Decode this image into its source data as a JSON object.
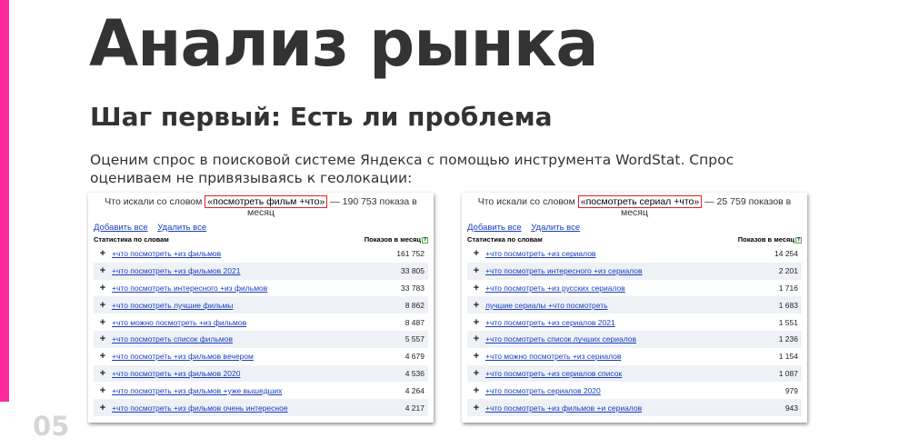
{
  "slide": {
    "title": "Анализ рынка",
    "subtitle": "Шаг первый: Есть ли проблема",
    "description": "Оценим спрос в поисковой системе Яндекса с помощью инструмента WordStat. Спрос оцениваем не привязываясь к геолокации:",
    "page_number": "05",
    "accent_color": "#ff2a9c"
  },
  "wordstat_left": {
    "prefix": "Что искали со словом",
    "phrase": "«посмотреть фильм +что»",
    "suffix": "— 190 753 показа в месяц",
    "add_all": "Добавить все",
    "remove_all": "Удалить все",
    "col_phrase": "Статистика по словам",
    "col_count": "Показов в месяц",
    "help_icon": "?",
    "rows": [
      {
        "icon": "+",
        "phrase": "+что посмотреть +из фильмов",
        "count": "161 752"
      },
      {
        "icon": "+",
        "phrase": "+что посмотреть +из фильмов 2021",
        "count": "33 805"
      },
      {
        "icon": "+",
        "phrase": "+что посмотреть интересного +из фильмов",
        "count": "33 783"
      },
      {
        "icon": "+",
        "phrase": "+что посмотреть лучшие фильмы",
        "count": "8 862"
      },
      {
        "icon": "+",
        "phrase": "+что можно посмотреть +из фильмов",
        "count": "8 487"
      },
      {
        "icon": "+",
        "phrase": "+что посмотреть список фильмов",
        "count": "5 557"
      },
      {
        "icon": "+",
        "phrase": "+что посмотреть +из фильмов вечером",
        "count": "4 679"
      },
      {
        "icon": "+",
        "phrase": "+что посмотреть +из фильмов 2020",
        "count": "4 536"
      },
      {
        "icon": "+",
        "phrase": "+что посмотреть +из фильмов +уже вышедших",
        "count": "4 264"
      },
      {
        "icon": "+",
        "phrase": "+что посмотреть +из фильмов очень интересное",
        "count": "4 217"
      }
    ]
  },
  "wordstat_right": {
    "prefix": "Что искали со словом",
    "phrase": "«посмотреть сериал +что»",
    "suffix": "— 25 759 показов в месяц",
    "add_all": "Добавить все",
    "remove_all": "Удалить все",
    "col_phrase": "Статистика по словам",
    "col_count": "Показов в месяц",
    "help_icon": "?",
    "rows": [
      {
        "icon": "+",
        "phrase": "+что посмотреть +из сериалов",
        "count": "14 254"
      },
      {
        "icon": "+",
        "phrase": "+что посмотреть интересного +из сериалов",
        "count": "2 201"
      },
      {
        "icon": "+",
        "phrase": "+что посмотреть +из русских сериалов",
        "count": "1 716"
      },
      {
        "icon": "+",
        "phrase": "лучшие сериалы +что посмотреть",
        "count": "1 683"
      },
      {
        "icon": "+",
        "phrase": "+что посмотреть +из сериалов 2021",
        "count": "1 551"
      },
      {
        "icon": "+",
        "phrase": "+что посмотреть список лучших сериалов",
        "count": "1 236"
      },
      {
        "icon": "+",
        "phrase": "+что можно посмотреть +из сериалов",
        "count": "1 154"
      },
      {
        "icon": "+",
        "phrase": "+что посмотреть +из сериалов список",
        "count": "1 087"
      },
      {
        "icon": "+",
        "phrase": "+что посмотреть сериалов 2020",
        "count": "979"
      },
      {
        "icon": "+",
        "phrase": "+что посмотреть +из фильмов +и сериалов",
        "count": "943"
      }
    ]
  }
}
